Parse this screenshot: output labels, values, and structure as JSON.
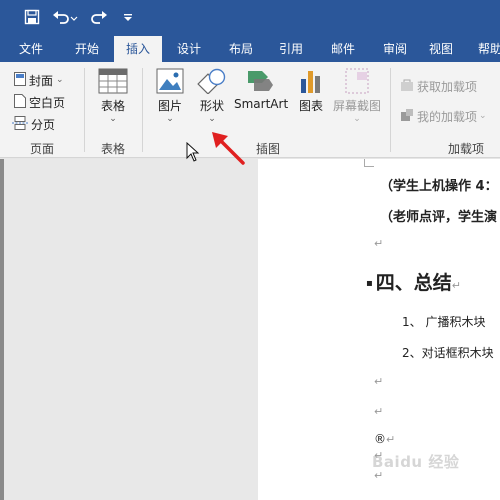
{
  "tabs": [
    "文件",
    "开始",
    "插入",
    "设计",
    "布局",
    "引用",
    "邮件",
    "审阅",
    "视图",
    "帮助"
  ],
  "active_tab": "插入",
  "ribbon": {
    "pages_group": {
      "label": "页面",
      "cover": "封面",
      "blank_page": "空白页",
      "page_break": "分页"
    },
    "tables_group": {
      "label": "表格",
      "table": "表格"
    },
    "illustrations_group": {
      "label": "插图",
      "pictures": "图片",
      "shapes": "形状",
      "smartart": "SmartArt",
      "chart": "图表",
      "screenshot": "屏幕截图"
    },
    "addins_group": {
      "label": "加载项",
      "get_addins": "获取加载项",
      "my_addins": "我的加载项"
    }
  },
  "document": {
    "lines": [
      "（学生上机操作 4：",
      "（老师点评，学生演",
      "四、总结",
      "1、 广播积木块",
      "2、对话框积木块",
      "®"
    ]
  },
  "watermark": "Baidu 经验",
  "colors": {
    "brand": "#2b579a",
    "ribbon_bg": "#f3f3f3",
    "arrow": "#e02020"
  }
}
